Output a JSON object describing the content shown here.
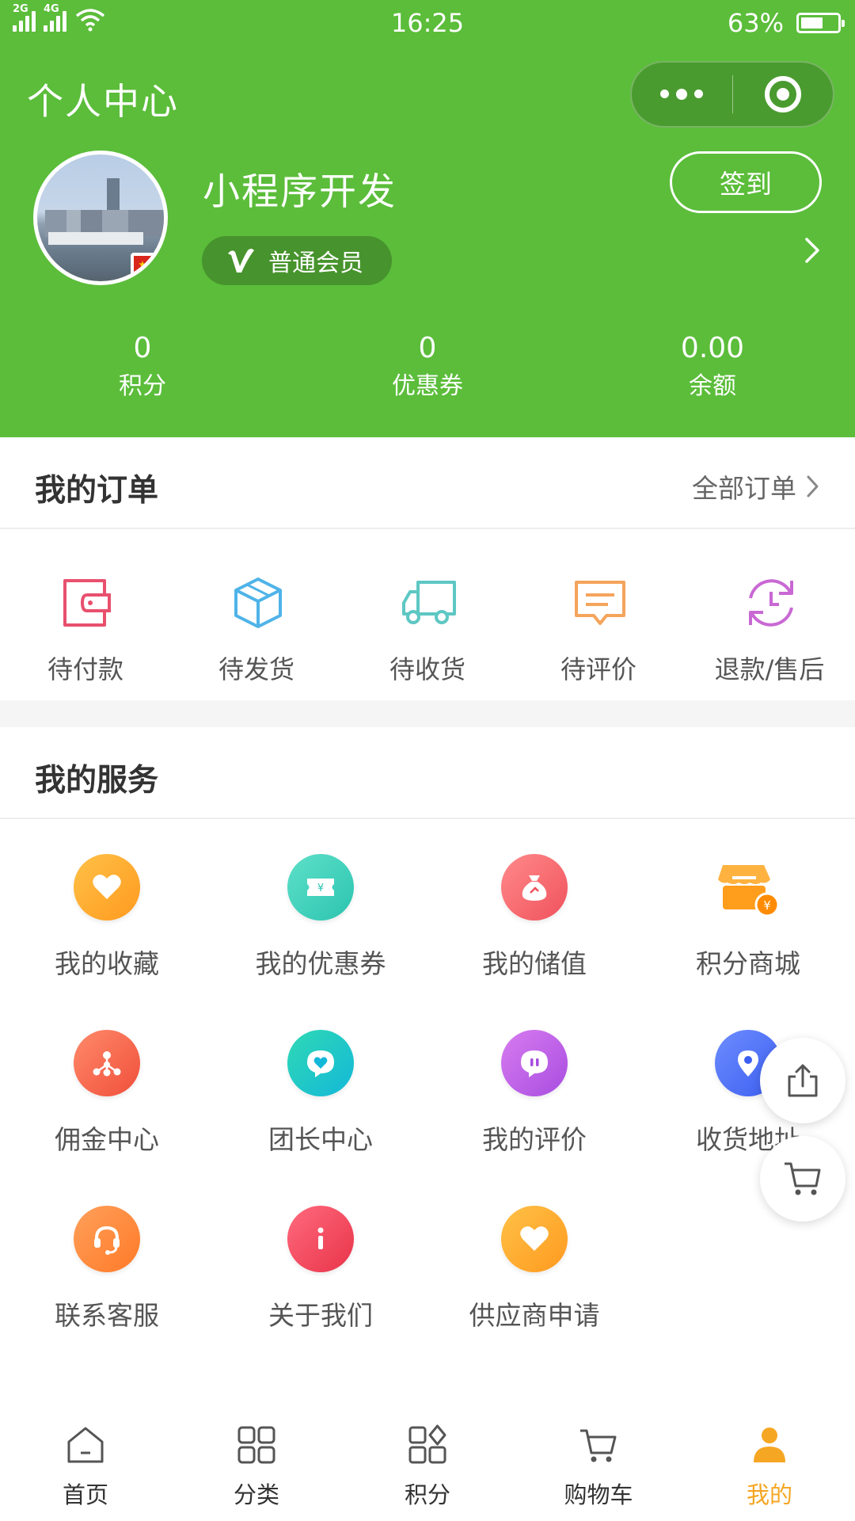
{
  "status_bar": {
    "sim1": "2G",
    "sim2": "4G",
    "time": "16:25",
    "battery": "63%"
  },
  "header": {
    "title": "个人中心",
    "username": "小程序开发",
    "member_level": "普通会员",
    "signin_label": "签到",
    "bg_color": "#5bbd3a"
  },
  "stats": [
    {
      "value": "0",
      "label": "积分"
    },
    {
      "value": "0",
      "label": "优惠券"
    },
    {
      "value": "0.00",
      "label": "余额"
    }
  ],
  "orders": {
    "title": "我的订单",
    "all_label": "全部订单",
    "items": [
      {
        "label": "待付款",
        "icon": "wallet-icon",
        "color": "#e9506e"
      },
      {
        "label": "待发货",
        "icon": "box-icon",
        "color": "#4fb3e8"
      },
      {
        "label": "待收货",
        "icon": "truck-icon",
        "color": "#5ec7c3"
      },
      {
        "label": "待评价",
        "icon": "comment-icon",
        "color": "#f5a45b"
      },
      {
        "label": "退款/售后",
        "icon": "refresh-icon",
        "color": "#c968d4"
      }
    ]
  },
  "services": {
    "title": "我的服务",
    "items": [
      {
        "label": "我的收藏",
        "icon": "heart-icon"
      },
      {
        "label": "我的优惠券",
        "icon": "ticket-icon"
      },
      {
        "label": "我的储值",
        "icon": "moneybag-icon"
      },
      {
        "label": "积分商城",
        "icon": "store-icon"
      },
      {
        "label": "佣金中心",
        "icon": "network-icon"
      },
      {
        "label": "团长中心",
        "icon": "chat-heart-icon"
      },
      {
        "label": "我的评价",
        "icon": "chat-quote-icon"
      },
      {
        "label": "收货地址",
        "icon": "location-icon"
      },
      {
        "label": "联系客服",
        "icon": "headset-icon"
      },
      {
        "label": "关于我们",
        "icon": "info-icon"
      },
      {
        "label": "供应商申请",
        "icon": "heart-icon"
      }
    ]
  },
  "tabs": [
    {
      "label": "首页",
      "icon": "home-icon"
    },
    {
      "label": "分类",
      "icon": "grid-icon"
    },
    {
      "label": "积分",
      "icon": "points-grid-icon"
    },
    {
      "label": "购物车",
      "icon": "cart-icon"
    },
    {
      "label": "我的",
      "icon": "user-icon",
      "active": true
    }
  ],
  "accent_colors": {
    "tab_active": "#f5a623",
    "header": "#5bbd3a"
  }
}
